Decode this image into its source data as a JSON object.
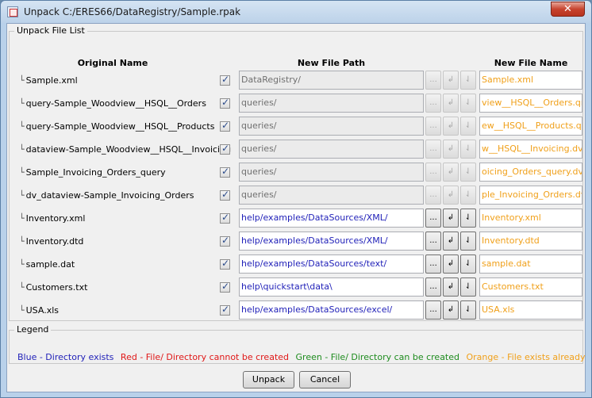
{
  "window": {
    "title": "Unpack C:/ERES66/DataRegistry/Sample.rpak",
    "close_glyph": "✕"
  },
  "unpack_list": {
    "title": "Unpack File List",
    "headers": {
      "original": "Original Name",
      "path": "New File Path",
      "name": "New File Name"
    },
    "tree_glyph": "└",
    "rows": [
      {
        "original": "Sample.xml",
        "path": "DataRegistry/",
        "name": "Sample.xml",
        "enabled": false
      },
      {
        "original": "query-Sample_Woodview__HSQL__Orders",
        "path": "queries/",
        "name": "view__HSQL__Orders.qry",
        "enabled": false
      },
      {
        "original": "query-Sample_Woodview__HSQL__Products",
        "path": "queries/",
        "name": "ew__HSQL__Products.qry",
        "enabled": false
      },
      {
        "original": "dataview-Sample_Woodview__HSQL__Invoicing",
        "path": "queries/",
        "name": "w__HSQL__Invoicing.dvw",
        "enabled": false
      },
      {
        "original": "Sample_Invoicing_Orders_query",
        "path": "queries/",
        "name": "oicing_Orders_query.dvw",
        "enabled": false
      },
      {
        "original": "dv_dataview-Sample_Invoicing_Orders",
        "path": "queries/",
        "name": "ple_Invoicing_Orders.dvw",
        "enabled": false
      },
      {
        "original": "Inventory.xml",
        "path": "help/examples/DataSources/XML/",
        "name": "Inventory.xml",
        "enabled": true
      },
      {
        "original": "Inventory.dtd",
        "path": "help/examples/DataSources/XML/",
        "name": "Inventory.dtd",
        "enabled": true
      },
      {
        "original": "sample.dat",
        "path": "help/examples/DataSources/text/",
        "name": "sample.dat",
        "enabled": true
      },
      {
        "original": "Customers.txt",
        "path": "help\\quickstart\\data\\",
        "name": "Customers.txt",
        "enabled": true
      },
      {
        "original": "USA.xls",
        "path": "help/examples/DataSources/excel/",
        "name": "USA.xls",
        "enabled": true
      }
    ],
    "row_buttons": {
      "browse": "...",
      "apply_one": "↲",
      "apply_all": "⇃"
    }
  },
  "legend": {
    "title": "Legend",
    "items": [
      {
        "text": "Blue - Directory exists",
        "color": "#1f1fb8"
      },
      {
        "text": "Red - File/ Directory cannot be created",
        "color": "#e01818"
      },
      {
        "text": "Green - File/ Directory can be created",
        "color": "#1e8c1e"
      },
      {
        "text": "Orange - File exists already",
        "color": "#f0a01a"
      }
    ]
  },
  "buttons": {
    "unpack": "Unpack",
    "cancel": "Cancel"
  }
}
